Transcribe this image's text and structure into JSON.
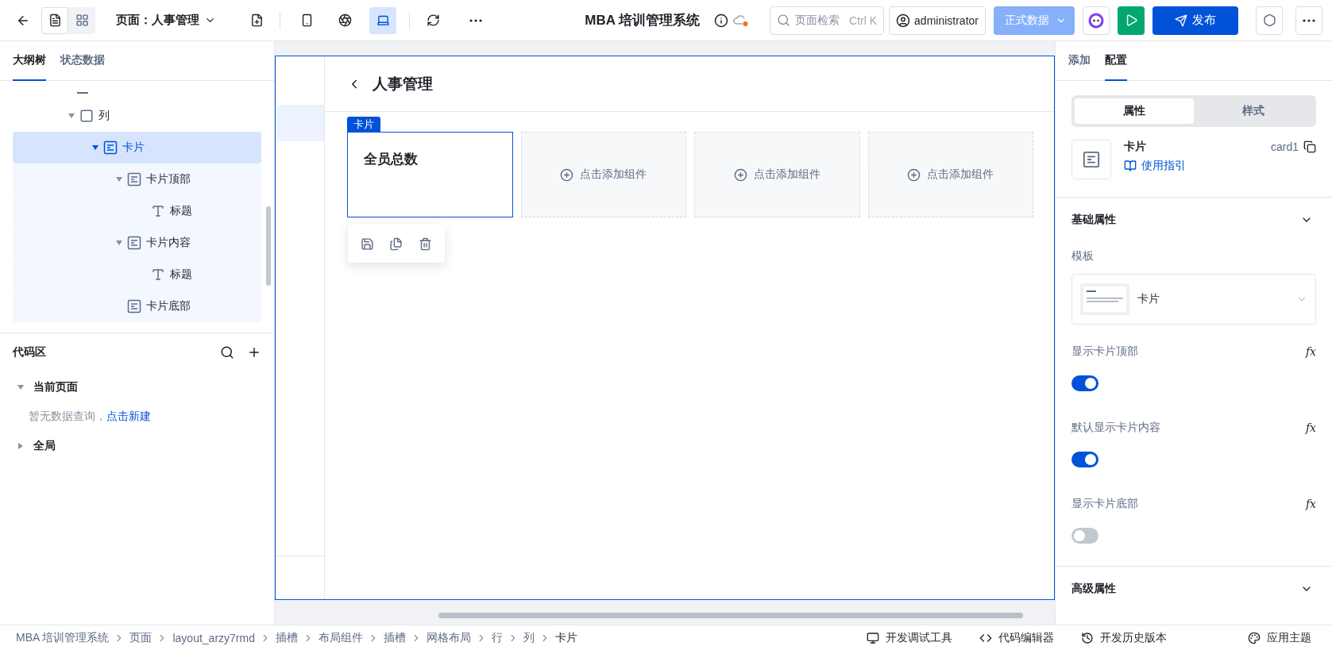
{
  "topbar": {
    "page_selector": "页面：人事管理",
    "device_modes": [
      {
        "kind": "mobile",
        "selected": false
      },
      {
        "kind": "mini",
        "selected": false
      },
      {
        "kind": "desktop",
        "selected": true
      }
    ],
    "view_modes": [
      {
        "kind": "outline",
        "selected": true
      },
      {
        "kind": "layout",
        "selected": false
      }
    ],
    "title": "MBA 培训管理系统",
    "search": {
      "placeholder": "页面检索",
      "shortcut": "Ctrl K"
    },
    "user": "administrator",
    "data_source": "正式数据",
    "publish": "发布"
  },
  "left_panel": {
    "tabs": [
      {
        "label": "大纲树",
        "selected": true
      },
      {
        "label": "状态数据",
        "selected": false
      }
    ],
    "tree": [
      {
        "label": "列",
        "kind": "column",
        "expanded": true,
        "selected": false,
        "children": [
          {
            "label": "卡片",
            "kind": "card",
            "expanded": true,
            "selected": true,
            "children": [
              {
                "label": "卡片顶部",
                "kind": "card",
                "expanded": true,
                "selected": false,
                "children": [
                  {
                    "label": "标题",
                    "kind": "text",
                    "selected": false
                  }
                ]
              },
              {
                "label": "卡片内容",
                "kind": "card",
                "expanded": true,
                "selected": false,
                "children": [
                  {
                    "label": "标题",
                    "kind": "text",
                    "selected": false
                  }
                ]
              },
              {
                "label": "卡片底部",
                "kind": "card",
                "selected": false
              }
            ]
          }
        ]
      }
    ],
    "code_area": {
      "title": "代码区",
      "groups": [
        {
          "label": "当前页面",
          "expanded": true,
          "empty_text": "暂无数据查询，",
          "empty_link": "点击新建"
        },
        {
          "label": "全局",
          "expanded": false
        }
      ]
    }
  },
  "canvas": {
    "page_title": "人事管理",
    "selected_label": "卡片",
    "cards": [
      {
        "kind": "card",
        "title": "全员总数",
        "selected": true
      },
      {
        "kind": "placeholder",
        "text": "点击添加组件"
      },
      {
        "kind": "placeholder",
        "text": "点击添加组件"
      },
      {
        "kind": "placeholder",
        "text": "点击添加组件"
      }
    ]
  },
  "right_panel": {
    "tabs": [
      {
        "label": "添加",
        "selected": false
      },
      {
        "label": "配置",
        "selected": true
      }
    ],
    "segments": [
      {
        "label": "属性",
        "selected": true
      },
      {
        "label": "样式",
        "selected": false
      }
    ],
    "component": {
      "name": "卡片",
      "guide": "使用指引",
      "id": "card1"
    },
    "sections": [
      {
        "title": "基础属性",
        "expanded": true
      },
      {
        "title": "高级属性",
        "expanded": false
      }
    ],
    "template": {
      "label": "模板",
      "value": "卡片"
    },
    "toggles": [
      {
        "label": "显示卡片顶部",
        "formula": "fx",
        "on": true
      },
      {
        "label": "默认显示卡片内容",
        "formula": "fx",
        "on": true
      },
      {
        "label": "显示卡片底部",
        "formula": "fx",
        "on": false
      }
    ]
  },
  "status_bar": {
    "breadcrumb": [
      "MBA 培训管理系统",
      "页面",
      "layout_arzy7rmd",
      "插槽",
      "布局组件",
      "插槽",
      "网格布局",
      "行",
      "列",
      "卡片"
    ],
    "tools": [
      {
        "kind": "debug",
        "label": "开发调试工具"
      },
      {
        "kind": "code",
        "label": "代码编辑器"
      },
      {
        "kind": "history",
        "label": "开发历史版本"
      },
      {
        "kind": "theme",
        "label": "应用主题"
      }
    ]
  }
}
